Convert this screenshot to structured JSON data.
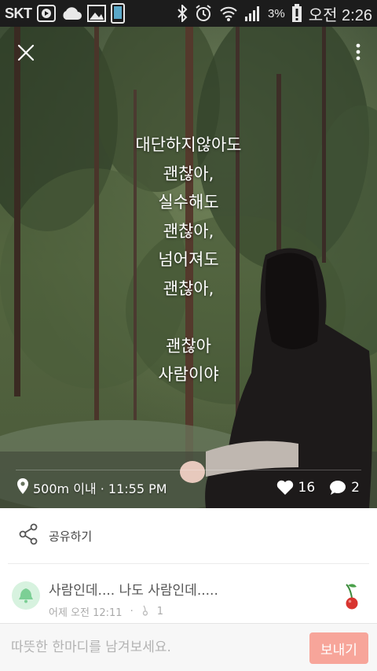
{
  "status_bar": {
    "carrier": "SKT",
    "battery_percent": "3%",
    "time": "오전 2:26",
    "icons": [
      "play-store-icon",
      "cloud-icon",
      "gallery-icon",
      "phone-icon",
      "bluetooth-icon",
      "alarm-icon",
      "wifi-icon",
      "signal-icon",
      "battery-icon"
    ]
  },
  "post": {
    "poem_lines": [
      "대단하지않아도",
      "괜찮아,",
      "실수해도",
      "괜찮아,",
      "넘어져도",
      "괜찮아,",
      "",
      "괜찮아",
      "사람이야"
    ],
    "location_time": "500m 이내 · 11:55 PM",
    "like_count": "16",
    "comment_count": "2"
  },
  "share": {
    "label": "공유하기"
  },
  "comment": {
    "text": "사람인데.... 나도 사람인데.....",
    "time": "어제 오전 12:11",
    "dot": "·",
    "likes": "1"
  },
  "input": {
    "placeholder": "따뜻한 한마디를 남겨보세요.",
    "send_label": "보내기"
  },
  "colors": {
    "send_button": "#f7a59a",
    "avatar_bg": "#d7f2df",
    "avatar_bell": "#7ccf95",
    "cherry": "#d8342f"
  }
}
